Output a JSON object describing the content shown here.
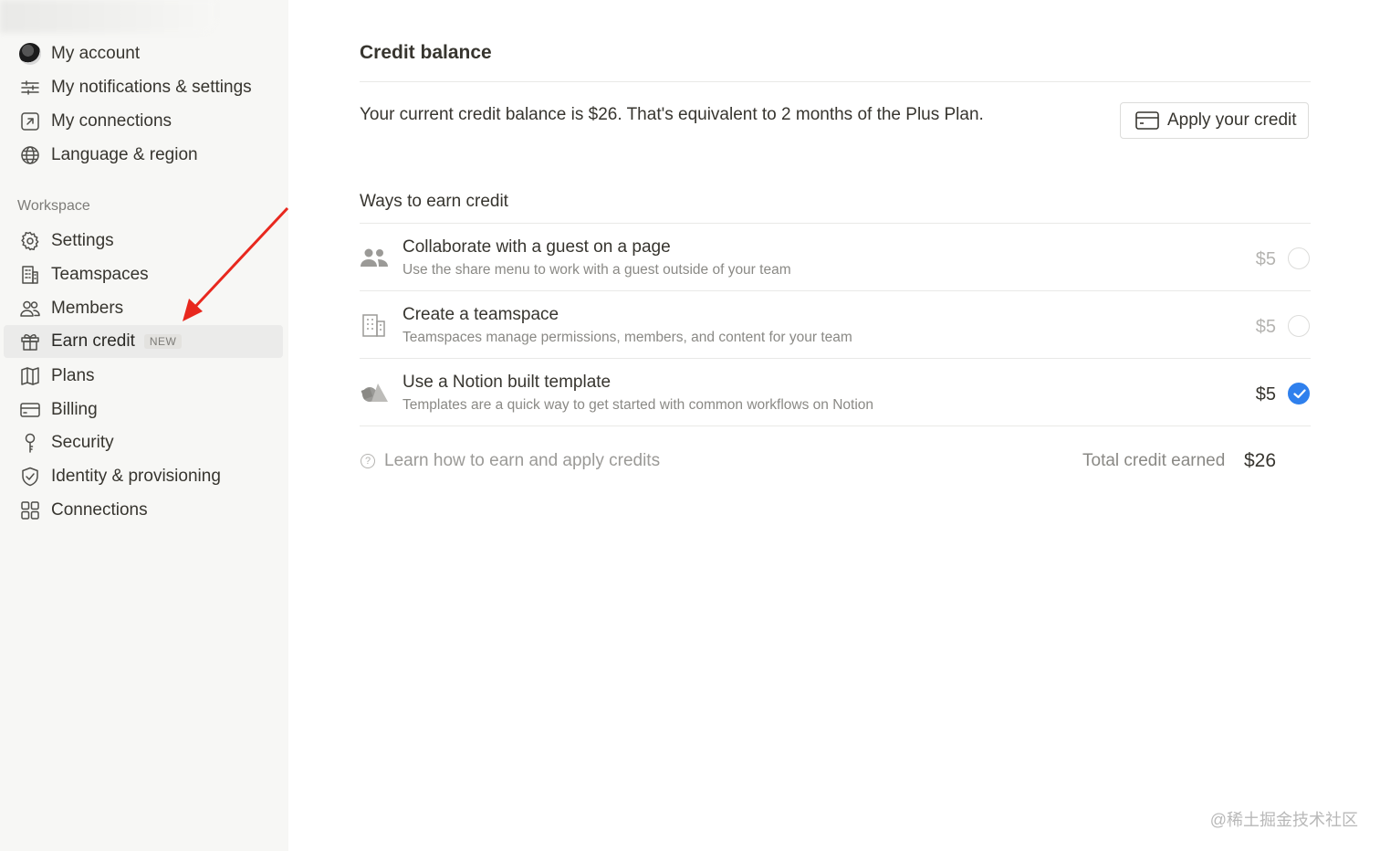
{
  "sidebar": {
    "account_items": [
      {
        "label": "My account",
        "icon": "avatar"
      },
      {
        "label": "My notifications & settings",
        "icon": "sliders-icon"
      },
      {
        "label": "My connections",
        "icon": "external-link-icon"
      },
      {
        "label": "Language & region",
        "icon": "globe-icon"
      }
    ],
    "workspace_label": "Workspace",
    "workspace_items": [
      {
        "label": "Settings",
        "icon": "gear-icon"
      },
      {
        "label": "Teamspaces",
        "icon": "building-icon"
      },
      {
        "label": "Members",
        "icon": "people-icon"
      },
      {
        "label": "Earn credit",
        "icon": "gift-icon",
        "badge": "NEW",
        "active": true
      },
      {
        "label": "Plans",
        "icon": "map-icon"
      },
      {
        "label": "Billing",
        "icon": "credit-card-icon"
      },
      {
        "label": "Security",
        "icon": "key-icon"
      },
      {
        "label": "Identity & provisioning",
        "icon": "shield-check-icon"
      },
      {
        "label": "Connections",
        "icon": "grid-icon"
      }
    ]
  },
  "main": {
    "title": "Credit balance",
    "balance": {
      "prefix": "Your current credit balance is ",
      "amount": "$26",
      "suffix": ". That's equivalent to 2 months of the Plus Plan."
    },
    "apply_button": "Apply your credit",
    "ways_title": "Ways to earn credit",
    "ways": [
      {
        "title": "Collaborate with a guest on a page",
        "desc": "Use the share menu to work with a guest outside of your team",
        "amount": "$5",
        "completed": false,
        "icon": "people-icon"
      },
      {
        "title": "Create a teamspace",
        "desc": "Teamspaces manage permissions, members, and content for your team",
        "amount": "$5",
        "completed": false,
        "icon": "building-icon"
      },
      {
        "title": "Use a Notion built template",
        "desc": "Templates are a quick way to get started with common workflows on Notion",
        "amount": "$5",
        "completed": true,
        "icon": "shapes-icon"
      }
    ],
    "learn_link": "Learn how to earn and apply credits",
    "total_label": "Total credit earned",
    "total_value": "$26"
  },
  "watermark": "@稀土掘金技术社区",
  "colors": {
    "accent": "#2f80ed",
    "sidebar_bg": "#f7f7f5",
    "annotation_arrow": "#e8281e"
  }
}
